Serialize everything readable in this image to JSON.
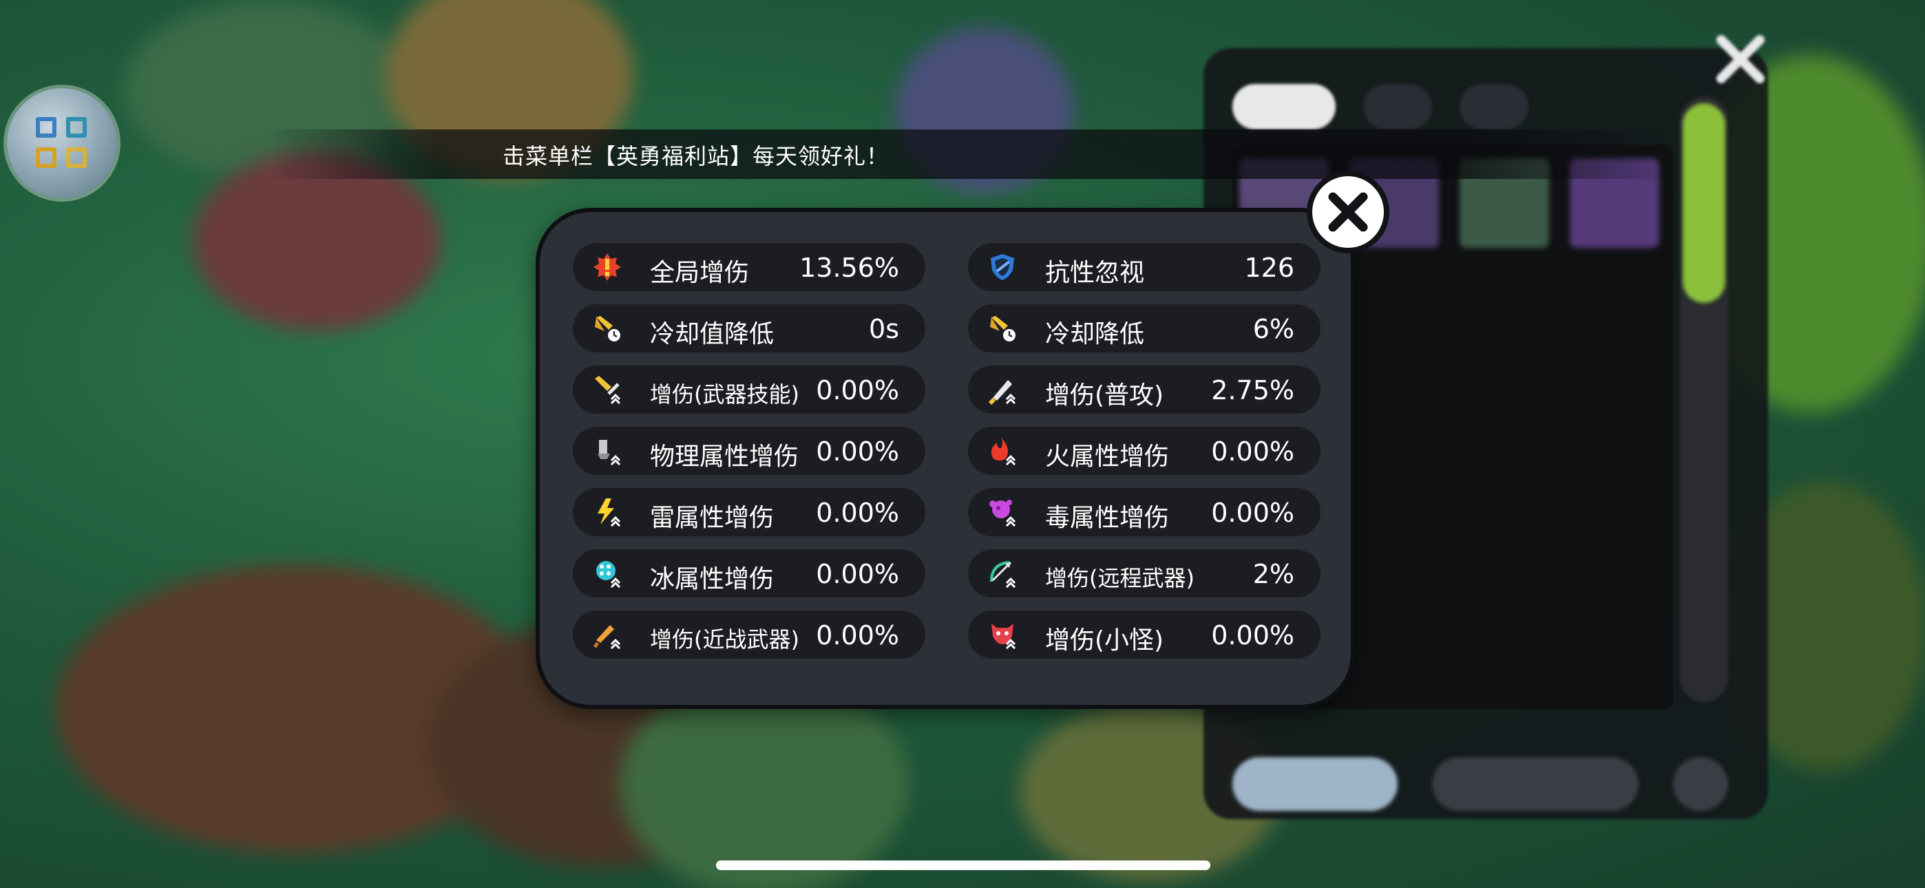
{
  "announcement": "击菜单栏【英勇福利站】每天领好礼！",
  "stats_left": [
    {
      "label": "全局增伤",
      "value": "13.56%",
      "icon": "damage-up-icon"
    },
    {
      "label": "冷却值降低",
      "value": "0s",
      "icon": "cooldown-value-icon"
    },
    {
      "label": "增伤(武器技能)",
      "value": "0.00%",
      "icon": "weapon-skill-icon"
    },
    {
      "label": "物理属性增伤",
      "value": "0.00%",
      "icon": "physical-icon"
    },
    {
      "label": "雷属性增伤",
      "value": "0.00%",
      "icon": "lightning-icon"
    },
    {
      "label": "冰属性增伤",
      "value": "0.00%",
      "icon": "ice-icon"
    },
    {
      "label": "增伤(近战武器)",
      "value": "0.00%",
      "icon": "melee-icon"
    }
  ],
  "stats_right": [
    {
      "label": "抗性忽视",
      "value": "126",
      "icon": "shield-icon"
    },
    {
      "label": "冷却降低",
      "value": "6%",
      "icon": "cooldown-icon"
    },
    {
      "label": "增伤(普攻)",
      "value": "2.75%",
      "icon": "normal-attack-icon"
    },
    {
      "label": "火属性增伤",
      "value": "0.00%",
      "icon": "fire-icon"
    },
    {
      "label": "毒属性增伤",
      "value": "0.00%",
      "icon": "poison-icon"
    },
    {
      "label": "增伤(远程武器)",
      "value": "2%",
      "icon": "ranged-icon"
    },
    {
      "label": "增伤(小怪)",
      "value": "0.00%",
      "icon": "minion-icon"
    }
  ],
  "colors": {
    "popup_bg": "#2e3037",
    "row_bg": "#1c1d22",
    "text": "#ffffff",
    "accent_green": "#8bbf3a"
  }
}
